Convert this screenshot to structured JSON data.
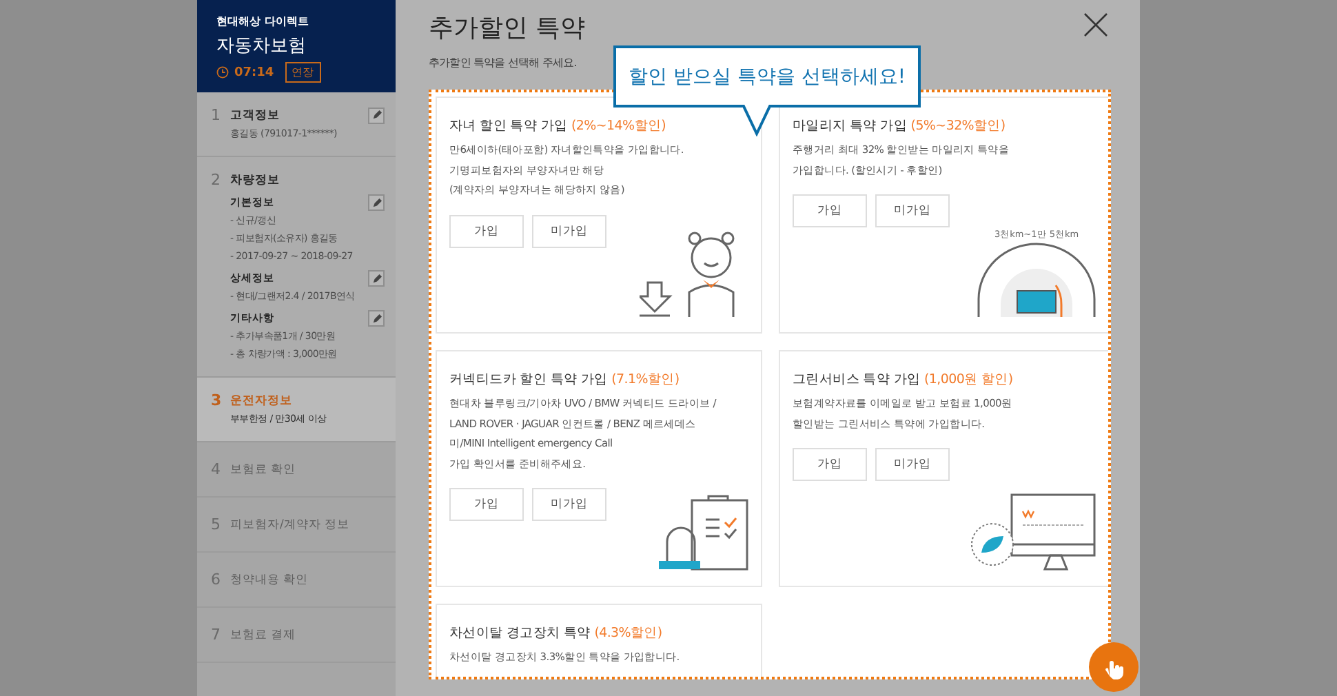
{
  "sidebar": {
    "brand": "현대해상 다이렉트",
    "product": "자동차보험",
    "timer": "07:14",
    "extend_button": "연장",
    "steps": [
      {
        "number": "1",
        "title": "고객정보",
        "active": false,
        "editable": true,
        "details": [
          "홍길동 (791017-1******)"
        ]
      },
      {
        "number": "2",
        "title": "차량정보",
        "active": false,
        "groups": [
          {
            "title": "기본정보",
            "editable": true,
            "lines": [
              "- 신규/갱신",
              "- 피보험자(소유자) 홍길동",
              "- 2017-09-27 ~ 2018-09-27"
            ]
          },
          {
            "title": "상세정보",
            "editable": true,
            "lines": [
              "- 현대/그랜저2.4 / 2017B연식"
            ]
          },
          {
            "title": "기타사항",
            "editable": true,
            "lines": [
              "- 추가부속품1개 / 30만원",
              "- 총 차량가액 : 3,000만원"
            ]
          }
        ]
      },
      {
        "number": "3",
        "title": "운전자정보",
        "active": true,
        "details": [
          "부부한정 / 만30세 이상"
        ]
      },
      {
        "number": "4",
        "title": "보험료 확인",
        "active": false
      },
      {
        "number": "5",
        "title": "피보험자/계약자 정보",
        "active": false
      },
      {
        "number": "6",
        "title": "청약내용 확인",
        "active": false
      },
      {
        "number": "7",
        "title": "보험료 결제",
        "active": false
      }
    ]
  },
  "modal": {
    "title": "추가할인 특약",
    "subtitle": "추가할인 특약을 선택해 주세요.",
    "tooltip": "할인 받으실 특약을 선택하세요!",
    "options": [
      {
        "kind": "child",
        "title": "자녀 할인 특약 가입",
        "discount": "(2%~14%할인)",
        "lines": [
          "만6세이하(태아포함) 자녀할인특약을 가입합니다.",
          "기명피보험자의 부양자녀만 해당",
          "(계약자의 부양자녀는 해당하지 않음)"
        ],
        "buttons": [
          "가입",
          "미가입"
        ]
      },
      {
        "kind": "mileage",
        "title": "마일리지 특약 가입",
        "discount": "(5%~32%할인)",
        "lines": [
          "주행거리 최대 32% 할인받는 마일리지 특약을",
          "가입합니다. (할인시기 - 후할인)"
        ],
        "buttons": [
          "가입",
          "미가입"
        ],
        "illustration_label": "3천km~1만 5천km"
      },
      {
        "kind": "connected",
        "title": "커넥티드카 할인 특약 가입",
        "discount": "(7.1%할인)",
        "lines": [
          "현대차 블루링크/기아차 UVO / BMW 커넥티드 드라이브 /",
          "LAND ROVER  ·  JAGUAR 인컨트롤 / BENZ 메르세데스",
          "미/MINI Intelligent emergency Call",
          "가입 확인서를 준비해주세요."
        ],
        "buttons": [
          "가입",
          "미가입"
        ]
      },
      {
        "kind": "green",
        "title": "그린서비스 특약 가입",
        "discount": "(1,000원 할인)",
        "lines": [
          "보험계약자료를 이메일로 받고 보험료 1,000원",
          "할인받는 그린서비스 특약에 가입합니다."
        ],
        "buttons": [
          "가입",
          "미가입"
        ]
      },
      {
        "kind": "lane",
        "title": "차선이탈 경고장치 특약",
        "discount": "(4.3%할인)",
        "lines": [
          "차선이탈 경고장치 3.3%할인 특약을 가입합니다."
        ]
      }
    ]
  }
}
